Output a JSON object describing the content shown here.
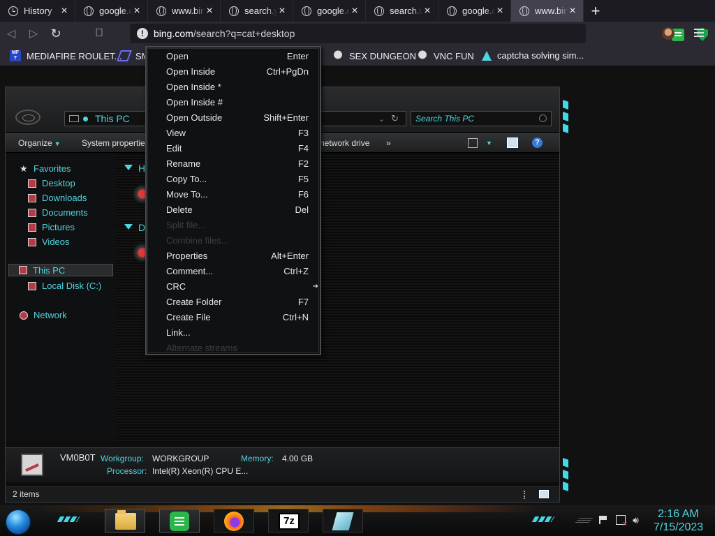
{
  "tabs": [
    {
      "title": "History",
      "icon": "history-icon",
      "active": false
    },
    {
      "title": "google.com",
      "icon": "globe-icon",
      "active": false
    },
    {
      "title": "www.bing.com",
      "icon": "globe-icon",
      "active": false
    },
    {
      "title": "search.yahoo",
      "icon": "globe-icon",
      "active": false
    },
    {
      "title": "google.com",
      "icon": "globe-icon",
      "active": false
    },
    {
      "title": "search.web",
      "icon": "globe-icon",
      "active": false
    },
    {
      "title": "google.com",
      "icon": "globe-icon",
      "active": false
    },
    {
      "title": "www.bing.com",
      "icon": "globe-icon",
      "active": true
    }
  ],
  "urlbar": {
    "domain": "bing.com",
    "path": "/search?q=cat+desktop"
  },
  "bookmarks": [
    {
      "label": "MEDIAFIRE ROULET...",
      "icon": "mediafire-icon"
    },
    {
      "label": "SM",
      "icon": "sm-icon"
    },
    {
      "label": "SEX DUNGEON",
      "icon": "skull-icon"
    },
    {
      "label": "VNC FUN",
      "icon": "skull-icon"
    },
    {
      "label": "captcha solving sim...",
      "icon": "triangle-icon"
    }
  ],
  "explorer": {
    "address": "This PC",
    "search_placeholder": "Search This PC",
    "toolbar": {
      "organize": "Organize",
      "system_properties": "System properties",
      "map_drive": "network drive",
      "more": "»"
    },
    "nav": {
      "favorites": "Favorites",
      "desktop": "Desktop",
      "downloads": "Downloads",
      "documents": "Documents",
      "pictures": "Pictures",
      "videos": "Videos",
      "this_pc": "This PC",
      "local_disk": "Local Disk (C:)",
      "network": "Network"
    },
    "groups": [
      "H",
      "D"
    ],
    "details": {
      "name": "VM0B0T",
      "workgroup_label": "Workgroup:",
      "workgroup": "WORKGROUP",
      "memory_label": "Memory:",
      "memory": "4.00 GB",
      "processor_label": "Processor:",
      "processor": "Intel(R) Xeon(R) CPU E..."
    },
    "status": "2 items"
  },
  "context_menu": [
    {
      "label": "Open",
      "shortcut": "Enter",
      "enabled": true
    },
    {
      "label": "Open Inside",
      "shortcut": "Ctrl+PgDn",
      "enabled": true
    },
    {
      "label": "Open Inside *",
      "shortcut": "",
      "enabled": true
    },
    {
      "label": "Open Inside #",
      "shortcut": "",
      "enabled": true
    },
    {
      "label": "Open Outside",
      "shortcut": "Shift+Enter",
      "enabled": true
    },
    {
      "label": "View",
      "shortcut": "F3",
      "enabled": true
    },
    {
      "label": "Edit",
      "shortcut": "F4",
      "enabled": true
    },
    {
      "label": "Rename",
      "shortcut": "F2",
      "enabled": true
    },
    {
      "label": "Copy To...",
      "shortcut": "F5",
      "enabled": true
    },
    {
      "label": "Move To...",
      "shortcut": "F6",
      "enabled": true
    },
    {
      "label": "Delete",
      "shortcut": "Del",
      "enabled": true
    },
    {
      "label": "Split file...",
      "shortcut": "",
      "enabled": false
    },
    {
      "label": "Combine files...",
      "shortcut": "",
      "enabled": false
    },
    {
      "label": "Properties",
      "shortcut": "Alt+Enter",
      "enabled": true
    },
    {
      "label": "Comment...",
      "shortcut": "Ctrl+Z",
      "enabled": true
    },
    {
      "label": "CRC",
      "shortcut": "",
      "enabled": true,
      "submenu": true
    },
    {
      "label": "Create Folder",
      "shortcut": "F7",
      "enabled": true
    },
    {
      "label": "Create File",
      "shortcut": "Ctrl+N",
      "enabled": true
    },
    {
      "label": "Link...",
      "shortcut": "",
      "enabled": true
    },
    {
      "label": "Alternate streams",
      "shortcut": "",
      "enabled": false
    }
  ],
  "taskbar": {
    "apps": [
      "folder-icon",
      "notes-icon",
      "firefox-icon",
      "7zip-icon",
      "glass-icon"
    ],
    "time": "2:16 AM",
    "date": "7/15/2023"
  },
  "colors": {
    "accent": "#4fd5e0",
    "menu_bg": "#101112",
    "disabled": "#3c3e40"
  }
}
